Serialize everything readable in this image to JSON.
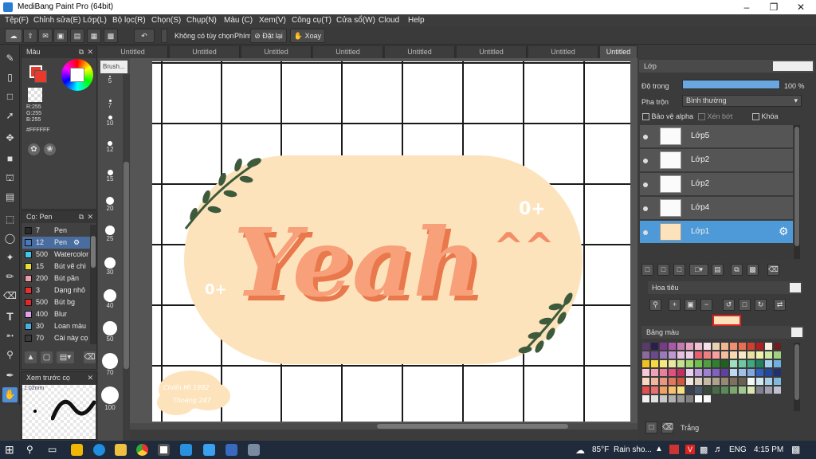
{
  "window": {
    "title": "MediBang Paint Pro (64bit)"
  },
  "menu": [
    "Tệp(F)",
    "Chỉnh sửa(E)",
    "Lớp(L)",
    "Bộ lọc(R)",
    "Chọn(S)",
    "Chụp(N)",
    "Màu (C)",
    "Xem(V)",
    "Công cụ(T)",
    "Cửa sổ(W)",
    "Cloud",
    "Help"
  ],
  "toolbar": {
    "correction_label": "Không có tùy chọn",
    "key_label": "Phím",
    "reset_label": "Đặt lại",
    "rotate_label": "Xoay"
  },
  "tabs": [
    "Untitled",
    "Untitled",
    "Untitled",
    "Untitled",
    "Untitled",
    "Untitled",
    "Untitled",
    "Untitled"
  ],
  "color_panel": {
    "title": "Màu",
    "r": "R:255",
    "g": "G:255",
    "b": "B:255",
    "hex": "#FFFFFF",
    "primary": "#e8392a",
    "secondary": "#ffffff"
  },
  "brush_panel": {
    "title": "Cọ: Pen",
    "items": [
      {
        "size": "7",
        "name": "Pen",
        "color": "#2a2a2a"
      },
      {
        "size": "12",
        "name": "Pen",
        "color": "#4a79b8",
        "selected": true
      },
      {
        "size": "500",
        "name": "Watercolor",
        "color": "#3fc8e8"
      },
      {
        "size": "15",
        "name": "Bút vẽ chì",
        "color": "#e8e03a"
      },
      {
        "size": "200",
        "name": "Bút pần",
        "color": "#ee9aa8"
      },
      {
        "size": "3",
        "name": "Dạng nhỏ",
        "color": "#e63030"
      },
      {
        "size": "500",
        "name": "Bút bg",
        "color": "#e02a2a"
      },
      {
        "size": "400",
        "name": "Blur",
        "color": "#e0a0e8"
      },
      {
        "size": "30",
        "name": "Loan màu",
        "color": "#4ab0e0"
      },
      {
        "size": "70",
        "name": "Cài này cọ",
        "color": "#3a3a3a"
      }
    ]
  },
  "brush_sizes_panel": {
    "title": "Brush...",
    "sizes": [
      "5",
      "7",
      "10",
      "12",
      "15",
      "20",
      "25",
      "30",
      "40",
      "50",
      "70",
      "100"
    ]
  },
  "preview_panel": {
    "title": "Xem trước cọ",
    "value": "1.02mm"
  },
  "canvas": {
    "word": "Yeah",
    "caret": "^^",
    "badge": "0+",
    "watermark_line1": "Chiến Mì 1982",
    "watermark_line2": "Thoảng 247",
    "bg_color": "#fde3bb",
    "text_color": "#f7a07a",
    "shadow_color": "#e9784c",
    "leaf_color": "#3d5a3c"
  },
  "layer_panel": {
    "title": "Lớp",
    "opacity_label": "Độ trong",
    "opacity_value": "100 %",
    "blend_label": "Pha trộn",
    "blend_value": "Bình thường",
    "protect_alpha": "Bảo vệ alpha",
    "clip": "Xén bớt",
    "lock": "Khóa",
    "layers": [
      {
        "name": "Lớp5"
      },
      {
        "name": "Lớp2"
      },
      {
        "name": "Lớp2"
      },
      {
        "name": "Lớp4"
      },
      {
        "name": "Lớp1",
        "selected": true
      }
    ]
  },
  "nav_panel": {
    "title": "Hoa tiêu"
  },
  "palette_panel": {
    "title": "Bảng màu",
    "footer_label": "Trắng",
    "colors": [
      "#5a3a6a",
      "#2a1f4a",
      "#7a3a8a",
      "#a85aa8",
      "#c67ab0",
      "#e8a0c0",
      "#f0c0d0",
      "#f8e0e8",
      "#e8d0b0",
      "#f0b890",
      "#f09070",
      "#e87050",
      "#d04030",
      "#b02020",
      "#f8f0e0",
      "#6a2020",
      "#8a6a9a",
      "#6a4a8a",
      "#9a7ab8",
      "#c098d0",
      "#e8c0e0",
      "#f0d0e8",
      "#e86070",
      "#f08080",
      "#f8a0a0",
      "#f0c0a0",
      "#f8d8b0",
      "#f8e8c8",
      "#e8e0a0",
      "#f0f0b0",
      "#d0e8a0",
      "#a0d080",
      "#f0c020",
      "#f8d840",
      "#f8e880",
      "#e8e8a0",
      "#c8e090",
      "#a0d870",
      "#70c050",
      "#50a040",
      "#308030",
      "#206020",
      "#a0e0c0",
      "#70c8a0",
      "#40a880",
      "#208060",
      "#a0d0f0",
      "#70b0e0",
      "#f8c8d8",
      "#f0a0b8",
      "#e8809a",
      "#e05080",
      "#c03060",
      "#e8d0f0",
      "#c0a0e0",
      "#a080d0",
      "#8060c0",
      "#6040a0",
      "#c0d8f0",
      "#a0c0e8",
      "#80a8e0",
      "#3060c0",
      "#2048a0",
      "#203070",
      "#f8d8c0",
      "#f0b8a0",
      "#e89880",
      "#e07860",
      "#d05840",
      "#f0e8e0",
      "#e0d0c0",
      "#c8b8a8",
      "#b0a090",
      "#988878",
      "#807060",
      "#686050",
      "#f0f8f8",
      "#d0e8f0",
      "#a8d0e8",
      "#80b8e0",
      "#e05050",
      "#e87070",
      "#f0a060",
      "#f8c070",
      "#f8e080",
      "#384050",
      "#485870",
      "#3a4a3a",
      "#4a6a4a",
      "#5a8a5a",
      "#7aa870",
      "#a0c890",
      "#d8e8b0",
      "#808090",
      "#a0a0b0",
      "#c0c0d0",
      "#f0f0f0",
      "#e0e0e0",
      "#c8c8c8",
      "#b0b0b0",
      "#989898",
      "#808080",
      "#ffffff",
      "#f8f8f8"
    ]
  },
  "taskbar": {
    "weather_temp": "85°F",
    "weather_text": "Rain sho...",
    "lang": "ENG",
    "time": "4:15 PM"
  }
}
